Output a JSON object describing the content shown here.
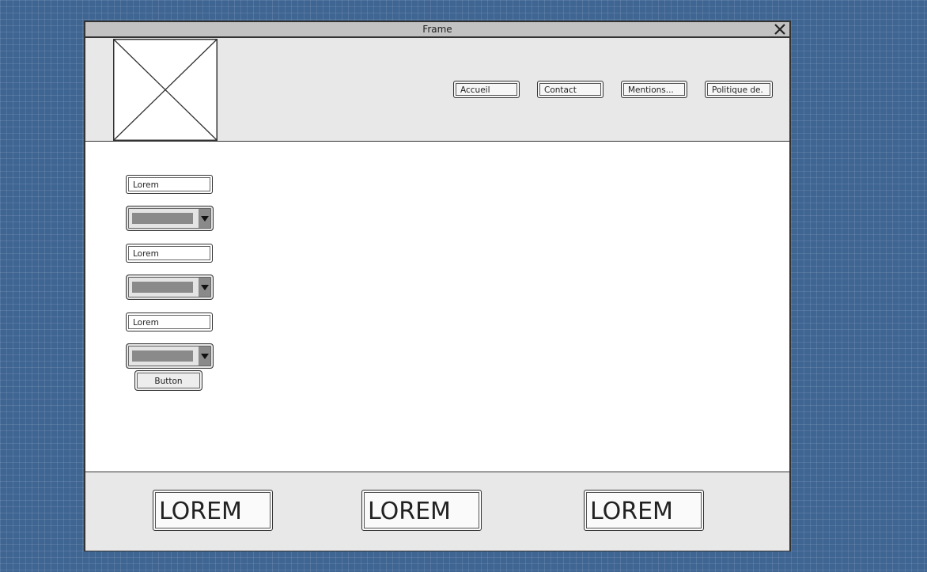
{
  "window": {
    "title": "Frame",
    "close_icon": "close-icon"
  },
  "header": {
    "logo_icon": "image-placeholder-icon",
    "nav": [
      "Accueil",
      "Contact",
      "Mentions...",
      "Politique de."
    ]
  },
  "form": {
    "fields": [
      "Lorem",
      "Lorem",
      "Lorem"
    ],
    "dropdown_icon": "chevron-down-icon",
    "button_label": "Button"
  },
  "footer": {
    "items": [
      "LOREM",
      "LOREM",
      "LOREM"
    ]
  }
}
